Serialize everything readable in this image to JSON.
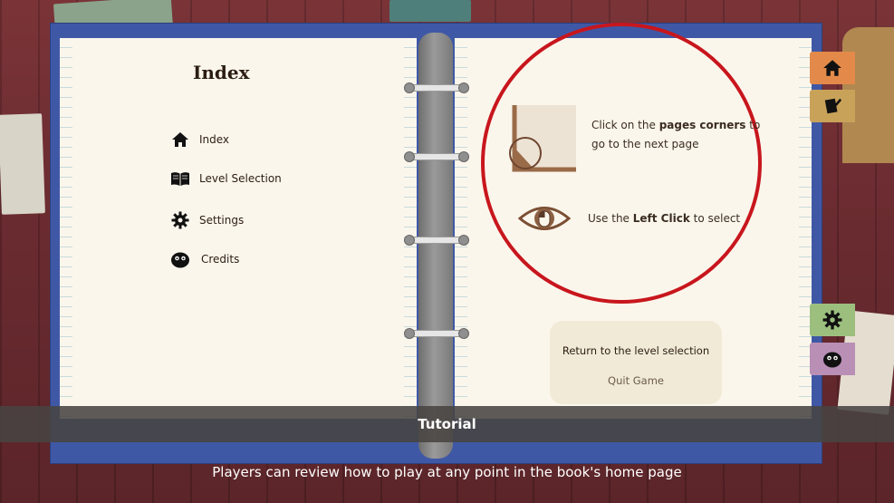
{
  "book": {
    "index_title": "Index",
    "menu": [
      {
        "label": "Index",
        "icon": "home-icon"
      },
      {
        "label": "Level Selection",
        "icon": "open-book-icon"
      },
      {
        "label": "Settings",
        "icon": "gear-icon"
      },
      {
        "label": "Credits",
        "icon": "blob-face-icon"
      }
    ]
  },
  "tutorial": {
    "corner_prefix": "Click on the ",
    "corner_bold": "pages corners",
    "corner_suffix_1": " to",
    "corner_suffix_2": "go to the next page",
    "click_prefix": "Use the ",
    "click_bold": "Left Click",
    "click_suffix": " to select"
  },
  "actions": {
    "return_label": "Return to the level selection",
    "quit_label": "Quit Game"
  },
  "tabs": [
    {
      "name": "home",
      "icon": "home-icon",
      "color": "#e38a4a"
    },
    {
      "name": "level-selection",
      "icon": "notebook-pencil-icon",
      "color": "#c9a25a"
    },
    {
      "name": "settings",
      "icon": "gear-icon",
      "color": "#9cbf7e"
    },
    {
      "name": "credits",
      "icon": "blob-face-icon",
      "color": "#b98fb6"
    }
  ],
  "banner_title": "Tutorial",
  "caption": "Players can review how to play at any point in the book's home page",
  "colors": {
    "binder": "#3f58a6",
    "highlight_circle": "#c8161d",
    "page": "#fbf6ec"
  }
}
